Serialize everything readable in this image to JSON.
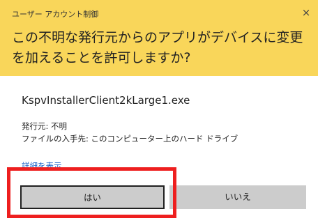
{
  "dialog": {
    "window_title": "ユーザー アカウント制御",
    "close_symbol": "×",
    "question": "この不明な発行元からのアプリがデバイスに変更を加えることを許可しますか?",
    "app_name": "KspvInstallerClient2kLarge1.exe",
    "publisher": "発行元: 不明",
    "origin": "ファイルの入手先: このコンピューター上のハード ドライブ",
    "details_link": "詳細を表示",
    "yes_label": "はい",
    "no_label": "いいえ"
  },
  "colors": {
    "header_background": "#f9d65a",
    "button_background": "#cccccc",
    "link": "#1a63c9",
    "highlight_border": "#ee1f1f"
  }
}
